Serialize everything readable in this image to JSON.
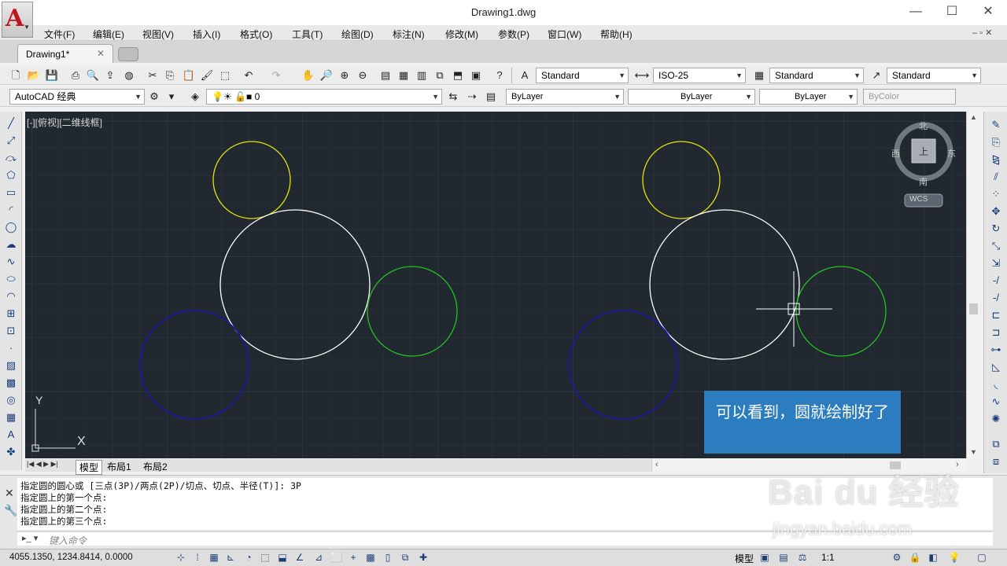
{
  "window": {
    "title": "Drawing1.dwg",
    "minimize": "—",
    "maximize": "☐",
    "close": "✕"
  },
  "menu": {
    "items": [
      "文件(F)",
      "编辑(E)",
      "视图(V)",
      "插入(I)",
      "格式(O)",
      "工具(T)",
      "绘图(D)",
      "标注(N)",
      "修改(M)",
      "参数(P)",
      "窗口(W)",
      "帮助(H)"
    ]
  },
  "tabs": {
    "doc_tab": "Drawing1*",
    "close": "✕"
  },
  "styles_toolbar": {
    "text_style": "Standard",
    "dim_style": "ISO-25",
    "table_style": "Standard",
    "multileader_style": "Standard"
  },
  "layers_toolbar": {
    "workspace": "AutoCAD 经典",
    "layer": "0",
    "color": "ByLayer",
    "linetype": "ByLayer",
    "lineweight": "ByLayer",
    "plotstyle": "ByColor"
  },
  "viewport": {
    "label": "[-][俯视][二维线框]",
    "compass": {
      "north": "北",
      "south": "南",
      "east": "东",
      "west": "西",
      "top": "上"
    },
    "ucs_button": "WCS",
    "ucs_axes": {
      "x": "X",
      "y": "Y"
    },
    "colors": {
      "background": "#212830",
      "yellow": "#e6e20a",
      "white": "#ffffff",
      "green": "#22c322",
      "blue": "#1717b0"
    }
  },
  "layout_tabs": {
    "model": "模型",
    "layout1": "布局1",
    "layout2": "布局2"
  },
  "command": {
    "history": [
      "指定圆的圆心或 [三点(3P)/两点(2P)/切点、切点、半径(T)]: 3P",
      "指定圆上的第一个点:",
      "指定圆上的第二个点:",
      "指定圆上的第三个点:"
    ],
    "input_placeholder": "键入命令"
  },
  "status": {
    "coords": "4055.1350, 1234.8414, 0.0000",
    "model_label": "模型",
    "scale": "1:1"
  },
  "overlay": {
    "caption": "可以看到，圆就绘制好了"
  },
  "watermark": {
    "brand": "Bai du 经验",
    "url": "jingyan.baidu.com"
  }
}
